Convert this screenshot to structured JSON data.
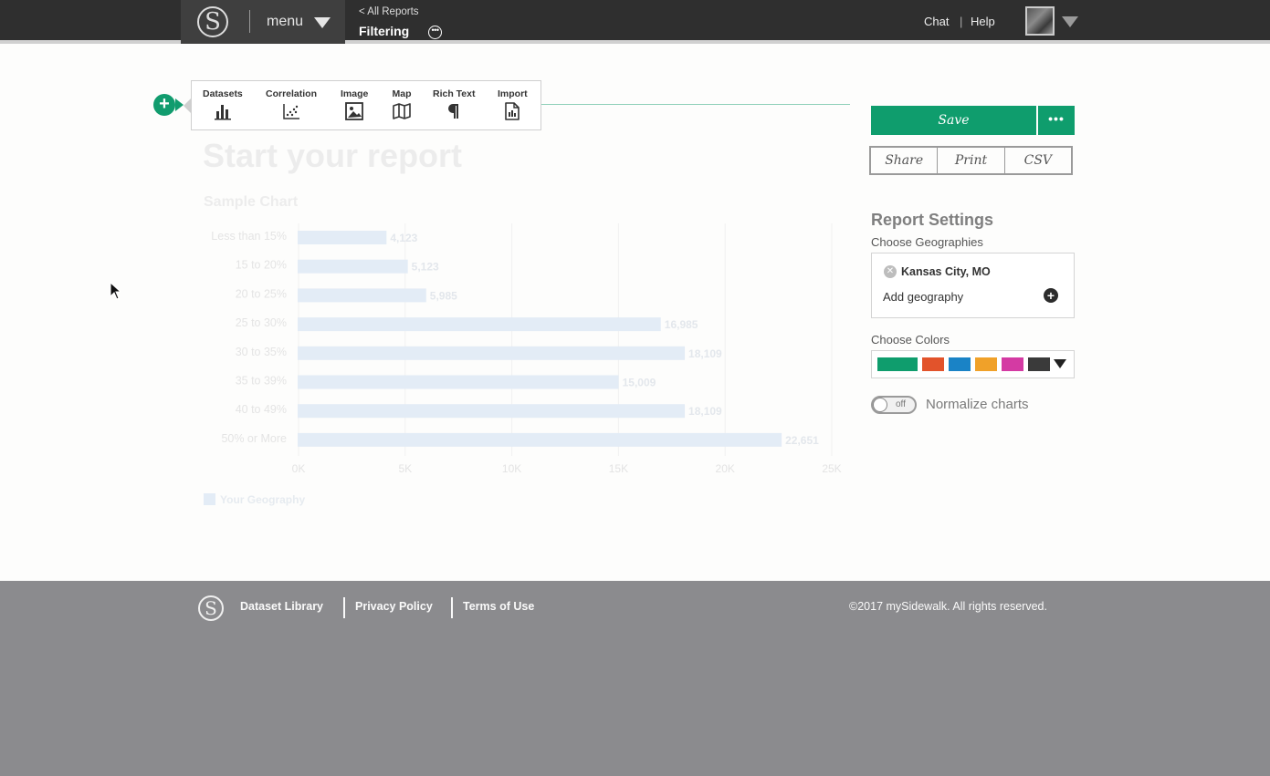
{
  "header": {
    "logo_letter": "S",
    "menu_label": "menu",
    "back_link": "< All Reports",
    "report_title": "Filtering",
    "chat_label": "Chat",
    "separator": "|",
    "help_label": "Help"
  },
  "insert_toolbar": {
    "items": [
      {
        "label": "Datasets",
        "icon": "bar-chart-icon"
      },
      {
        "label": "Correlation",
        "icon": "scatter-plot-icon"
      },
      {
        "label": "Image",
        "icon": "image-icon"
      },
      {
        "label": "Map",
        "icon": "map-icon"
      },
      {
        "label": "Rich Text",
        "icon": "paragraph-icon"
      },
      {
        "label": "Import",
        "icon": "import-document-icon"
      }
    ]
  },
  "report": {
    "title": "Start your report",
    "subtitle": "Sample Chart"
  },
  "chart_data": {
    "type": "bar",
    "orientation": "horizontal",
    "title": "Sample Chart",
    "categories": [
      "Less than 15%",
      "15 to 20%",
      "20 to 25%",
      "25 to 30%",
      "30 to 35%",
      "35 to 39%",
      "40 to 49%",
      "50% or More"
    ],
    "series": [
      {
        "name": "Your Geography",
        "values": [
          4123,
          5123,
          5985,
          16985,
          18109,
          15009,
          18109,
          22651
        ],
        "color": "#e3ecf6"
      }
    ],
    "value_labels": [
      "4,123",
      "5,123",
      "5,985",
      "16,985",
      "18,109",
      "15,009",
      "18,109",
      "22,651"
    ],
    "x_ticks": [
      "0K",
      "5K",
      "10K",
      "15K",
      "20K",
      "25K"
    ],
    "xlim": [
      0,
      25000
    ],
    "grid": true,
    "legend": "bottom-left"
  },
  "actions": {
    "save_label": "Save",
    "more_label": "•••",
    "share_label": "Share",
    "print_label": "Print",
    "csv_label": "CSV"
  },
  "settings": {
    "title": "Report Settings",
    "geographies_label": "Choose Geographies",
    "selected_geography": "Kansas City, MO",
    "add_geography_label": "Add geography",
    "colors_label": "Choose Colors",
    "colors": [
      "#0f9d6d",
      "#e2532b",
      "#1a83c6",
      "#f0a129",
      "#d43aa3",
      "#3a3a3a"
    ],
    "normalize_toggle_state": "off",
    "normalize_label": "Normalize charts"
  },
  "footer": {
    "links": [
      "Dataset Library",
      "Privacy Policy",
      "Terms of Use"
    ],
    "copyright": "©2017 mySidewalk. All rights reserved."
  }
}
